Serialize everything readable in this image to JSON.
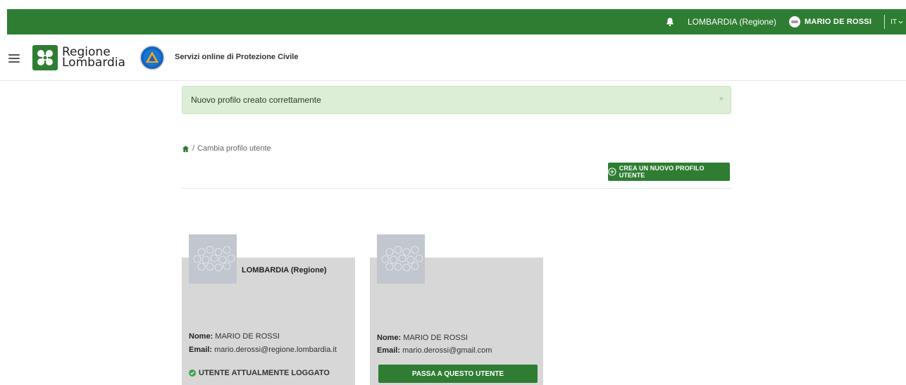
{
  "topbar": {
    "region": "LOMBARDIA (Regione)",
    "user": "MARIO DE ROSSI",
    "lang": "IT"
  },
  "header": {
    "logo_line1": "Regione",
    "logo_line2": "Lombardia",
    "service_title": "Servizi online di Protezione Civile"
  },
  "alert": {
    "message": "Nuovo profilo creato correttamente",
    "close": "×"
  },
  "breadcrumb": {
    "sep": "/",
    "current": "Cambia profilo utente"
  },
  "actions": {
    "create_profile": "CREA UN NUOVO PROFILO UTENTE"
  },
  "profiles": [
    {
      "title": "LOMBARDIA (Regione)",
      "name_label": "Nome:",
      "name": "MARIO DE ROSSI",
      "email_label": "Email:",
      "email": "mario.derossi@regione.lombardia.it",
      "status": "UTENTE ATTUALMENTE LOGGATO"
    },
    {
      "title": "",
      "name_label": "Nome:",
      "name": "MARIO DE ROSSI",
      "email_label": "Email:",
      "email": "mario.derossi@gmail.com",
      "switch_label": "PASSA A QUESTO UTENTE"
    }
  ],
  "colors": {
    "brand": "#2e7d32",
    "alert_bg": "#dcefd6",
    "card_bg": "#d7d7d7"
  },
  "icons": [
    "bell-icon",
    "user-avatar-icon",
    "chevron-down-icon",
    "hamburger-icon",
    "home-icon",
    "plus-circle-icon",
    "check-circle-icon",
    "close-icon"
  ]
}
